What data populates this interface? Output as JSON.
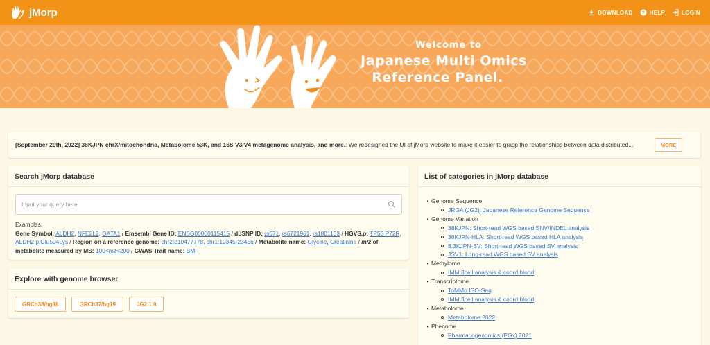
{
  "app": {
    "brand": "jMorp",
    "nav": {
      "download": "DOWNLOAD",
      "help": "HELP",
      "login": "LOGIN"
    }
  },
  "hero": {
    "line1": "Welcome to",
    "line2": "Japanese Multi Omics",
    "line3": "Reference Panel."
  },
  "notice": {
    "bold": "[September 29th, 2022] 38KJPN chrX/mitochondria, Metabolome 53K, and 16S V3/V4 metagenome analysis, and more.",
    "body": ": We redesigned the UI of jMorp website to make it easier to grasp the relationships between data distributed...",
    "more_label": "MORE"
  },
  "search": {
    "title": "Search jMorp database",
    "placeholder": "Input your query here",
    "examples_label": "Examples:",
    "gene_symbol_label": "Gene Symbol:",
    "gene_symbols": [
      "ALDH2",
      "NFE2L2",
      "GATA1"
    ],
    "ensembl_label": "Emsembl Gene ID:",
    "ensembl_ids": [
      "ENSG00000115415"
    ],
    "dbsnp_label": "dbSNP ID:",
    "dbsnp_ids": [
      "rs671",
      "rs6721961",
      "rs1801133"
    ],
    "hgvs_label": "HGVS.p:",
    "hgvs_ids": [
      "TP53 P72R",
      "ALDH2 p.Glu504Lys"
    ],
    "region_label": "Region on a reference genome:",
    "regions": [
      "chr2:210477778",
      "chr1:12345-23456"
    ],
    "metabolite_label": "Metabolite name:",
    "metabolites": [
      "Glycine",
      "Creatinine"
    ],
    "mz_label": "m/z",
    "mz_suffix": "of metabolite measured by MS:",
    "mz_values": [
      "100<mz<200"
    ],
    "gwas_label": "GWAS Trait name:",
    "gwas_traits": [
      "BMI"
    ],
    "sep": " / "
  },
  "browser": {
    "title": "Explore with genome browser",
    "buttons": [
      "GRCh38/hg38",
      "GRCh37/hg19",
      "JG2.1.0"
    ]
  },
  "categories": {
    "title": "List of categories in jMorp database",
    "groups": [
      {
        "label": "Genome Sequence",
        "items": [
          "JRGA (JG2): Japanese Reference Genome Sequence"
        ]
      },
      {
        "label": "Genome Variation",
        "items": [
          "38KJPN: Short-read WGS based SNV/INDEL analysis",
          "38KJPN-HLA: Short-read WGS based HLA analysis",
          "8.3KJPN-SV: Short-read WGS based SV analysis",
          "JSV1: Long-read WGS based SV analysis"
        ]
      },
      {
        "label": "Methylome",
        "items": [
          "IMM 3cell analysis & coord blood"
        ]
      },
      {
        "label": "Transcriptome",
        "items": [
          "ToMMo ISO-Seq",
          "IMM 3cell analysis & coord blood"
        ]
      },
      {
        "label": "Metabolome",
        "items": [
          "Metabolome 2022"
        ]
      },
      {
        "label": "Phenome",
        "items": [
          "Pharmacogenomics (PGx) 2021"
        ]
      }
    ]
  },
  "colors": {
    "primary": "#f29216",
    "hero": "#f8a85a",
    "link": "#3d76c7",
    "background": "#fdf8e6"
  }
}
